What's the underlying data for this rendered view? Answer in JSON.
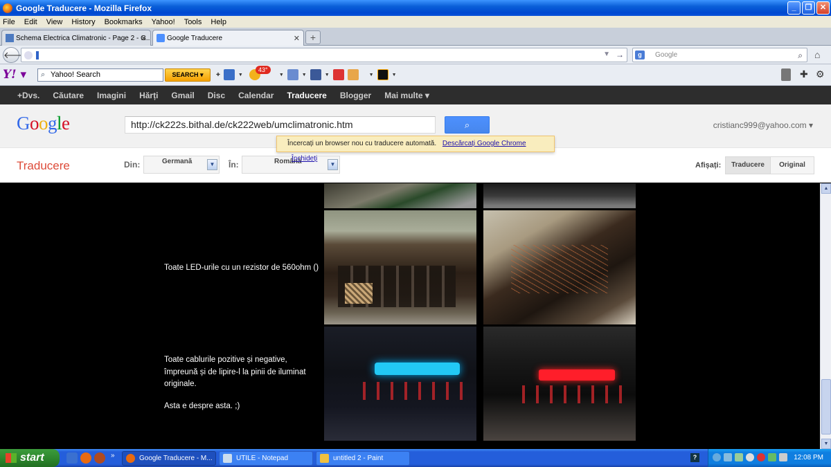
{
  "window": {
    "title": "Google Traducere - Mozilla Firefox"
  },
  "menu": [
    "File",
    "Edit",
    "View",
    "History",
    "Bookmarks",
    "Yahoo!",
    "Tools",
    "Help"
  ],
  "tabs": [
    {
      "label": "Schema Electrica Climatronic - Page 2 - G...",
      "active": false
    },
    {
      "label": "Google Traducere",
      "active": true
    }
  ],
  "nav": {
    "url": "",
    "search_placeholder": "Google"
  },
  "yahoo_toolbar": {
    "search_text": "Yahoo! Search",
    "search_button": "SEARCH",
    "weather_badge": "43°"
  },
  "google_bar": {
    "items": [
      "+Dvs.",
      "Căutare",
      "Imagini",
      "Hărți",
      "Gmail",
      "Disc",
      "Calendar",
      "Traducere",
      "Blogger",
      "Mai multe ▾"
    ],
    "active": "Traducere"
  },
  "google_header": {
    "logo": "Google",
    "url_value": "http://ck222s.bithal.de/ck222web/umclimatronic.htm",
    "user": "cristianc999@yahoo.com ▾"
  },
  "notice": {
    "text": "Încercați un browser nou cu traducere automată.",
    "link1": "Descărcați Google Chrome",
    "link2": "Închideți"
  },
  "translate_bar": {
    "title": "Traducere",
    "from_label": "Din:",
    "from_value": "Germană",
    "to_label": "În:",
    "to_value": "Română",
    "show_label": "Afișați:",
    "view_translation": "Traducere",
    "view_original": "Original"
  },
  "content": {
    "text1": "Toate LED-urile cu un rezistor de 560ohm ()",
    "text2": [
      "Toate cablurile pozitive și negative,",
      "împreună și de lipire-l la pinii de iluminat",
      "originale."
    ],
    "text3": "Asta e despre asta. ;)"
  },
  "taskbar": {
    "start": "start",
    "tasks": [
      {
        "label": "Google Traducere - M...",
        "active": true
      },
      {
        "label": "UTILE - Notepad",
        "active": false
      },
      {
        "label": "untitled 2 - Paint",
        "active": false
      }
    ],
    "clock": "12:08 PM"
  },
  "colors": {
    "google_red": "#dd4b39",
    "xp_blue": "#245edb",
    "search_blue": "#4d90fe"
  }
}
